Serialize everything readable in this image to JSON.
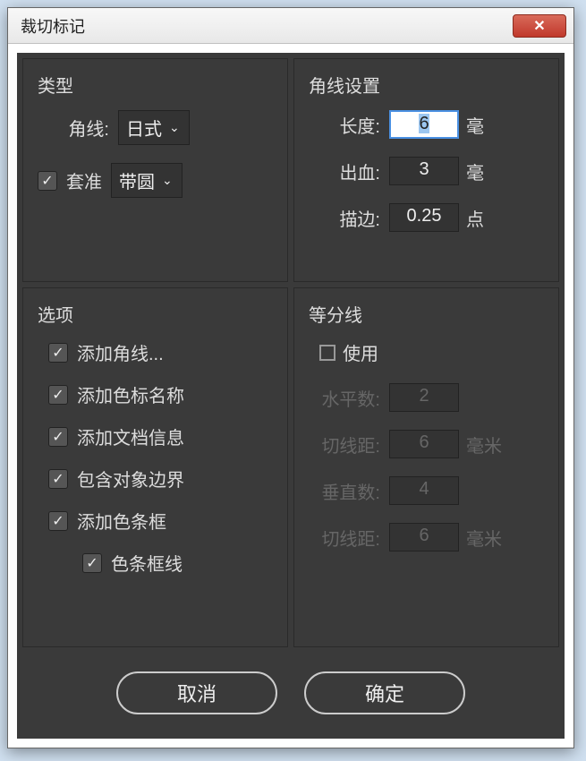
{
  "window": {
    "title": "裁切标记"
  },
  "type_panel": {
    "title": "类型",
    "corner_label": "角线:",
    "corner_value": "日式",
    "registration_checked": true,
    "registration_label": "套准",
    "registration_value": "带圆"
  },
  "corner_settings": {
    "title": "角线设置",
    "length_label": "长度:",
    "length_value": "6",
    "length_unit": "毫",
    "bleed_label": "出血:",
    "bleed_value": "3",
    "bleed_unit": "毫",
    "stroke_label": "描边:",
    "stroke_value": "0.25",
    "stroke_unit": "点"
  },
  "options": {
    "title": "选项",
    "items": [
      {
        "checked": true,
        "label": "添加角线..."
      },
      {
        "checked": true,
        "label": "添加色标名称"
      },
      {
        "checked": true,
        "label": "添加文档信息"
      },
      {
        "checked": true,
        "label": "包含对象边界"
      },
      {
        "checked": true,
        "label": "添加色条框"
      }
    ],
    "sub": {
      "checked": true,
      "label": "色条框线"
    }
  },
  "guides": {
    "title": "等分线",
    "use_label": "使用",
    "h_count_label": "水平数:",
    "h_count_value": "2",
    "h_dist_label": "切线距:",
    "h_dist_value": "6",
    "h_dist_unit": "毫米",
    "v_count_label": "垂直数:",
    "v_count_value": "4",
    "v_dist_label": "切线距:",
    "v_dist_value": "6",
    "v_dist_unit": "毫米"
  },
  "buttons": {
    "cancel": "取消",
    "ok": "确定"
  }
}
